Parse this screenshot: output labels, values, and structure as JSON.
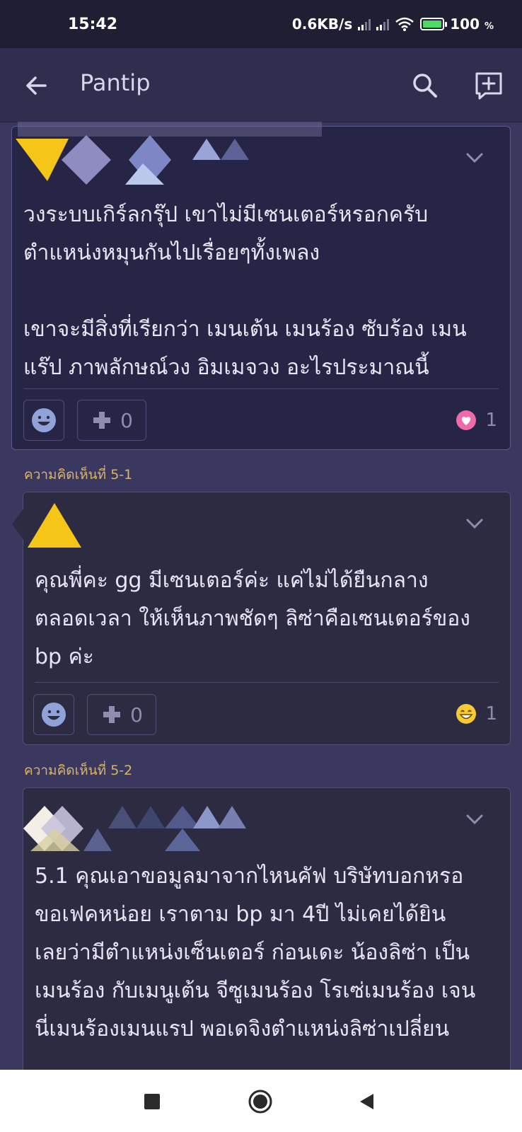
{
  "status_bar": {
    "time": "15:42",
    "network_speed": "0.6KB/s",
    "battery": "100",
    "battery_unit": "%"
  },
  "app_bar": {
    "title": "Pantip",
    "icons": [
      "back-arrow-icon",
      "search-icon",
      "new-post-icon"
    ]
  },
  "comments": [
    {
      "label": "",
      "text": "วงระบบเกิร์ลกรุ๊ป เขาไม่มีเซนเตอร์หรอกครับ\nตำแหน่งหมุนกันไปเรื่อยๆทั้งเพลง\n\nเขาจะมีสิ่งที่เรียกว่า เมนเต้น เมนร้อง ซับร้อง เมน\nแร๊ป ภาพลักษณ์วง อิมเมจวง อะไรประมาณนี้",
      "plus_count": "0",
      "reaction_icon": "heart-icon",
      "reaction_count": "1"
    },
    {
      "label": "ความคิดเห็นที่ 5-1",
      "text": "คุณพี่คะ gg มีเซนเตอร์ค่ะ แค่ไม่ได้ยืนกลาง\nตลอดเวลา ให้เห็นภาพชัดๆ ลิซ่าคือเซนเตอร์ของ\nbp ค่ะ",
      "plus_count": "0",
      "reaction_icon": "grin-emoji-icon",
      "reaction_count": "1"
    },
    {
      "label": "ความคิดเห็นที่ 5-2",
      "text": "5.1 คุณเอาขอมูลมาจากไหนคัฟ บริษัทบอกหรอ\nขอเฟคหน่อย เราตาม bp มา 4ปี ไม่เคยได้ยิน\nเลยว่ามีตำแหน่งเซ็นเตอร์ ก่อนเดะ น้องลิซ่า เป็น\nเมนร้อง กับเมนูเต้น จีซูเมนร้อง โรเซ่เมนร้อง เจน\nนี่เมนร้องเมนแรป พอเดจิงตำแหน่งลิซ่าเปลี่ยน"
    }
  ],
  "colors": {
    "background": "#3a385f",
    "card_highlight": "#262546",
    "card": "#2c2b42",
    "label_gold": "#d8b46a"
  }
}
